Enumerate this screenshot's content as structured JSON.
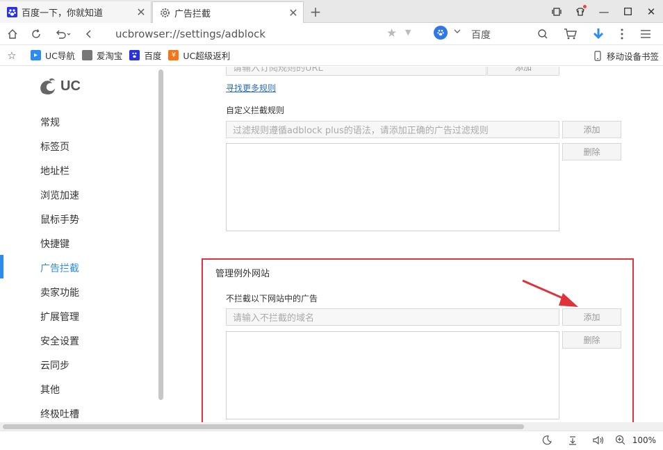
{
  "tabs": [
    {
      "title": "百度一下，你就知道",
      "icon": "baidu-paw-icon"
    },
    {
      "title": "广告拦截",
      "icon": "gear-icon"
    }
  ],
  "address": {
    "url": "ucbrowser://settings/adblock"
  },
  "search": {
    "engine": "百度"
  },
  "bookmarks": [
    {
      "label": "UC导航",
      "icon": "uc-nav-icon"
    },
    {
      "label": "爱淘宝",
      "icon": "page-icon"
    },
    {
      "label": "百度",
      "icon": "baidu-paw-icon"
    },
    {
      "label": "UC超级返利",
      "icon": "uc-rebate-icon"
    }
  ],
  "mobile_bookmarks": "移动设备书签",
  "logo": {
    "text": "UC"
  },
  "sidebar": {
    "items": [
      {
        "label": "常规"
      },
      {
        "label": "标签页"
      },
      {
        "label": "地址栏"
      },
      {
        "label": "浏览加速"
      },
      {
        "label": "鼠标手势"
      },
      {
        "label": "快捷键"
      },
      {
        "label": "广告拦截"
      },
      {
        "label": "卖家功能"
      },
      {
        "label": "扩展管理"
      },
      {
        "label": "安全设置"
      },
      {
        "label": "云同步"
      },
      {
        "label": "其他"
      },
      {
        "label": "终极吐槽"
      }
    ],
    "active_index": 6
  },
  "main": {
    "subscribe_placeholder": "请输入订阅规则的URL",
    "subscribe_add": "添加",
    "find_more": "寻找更多规则",
    "custom_rules_label": "自定义拦截规则",
    "custom_rules_placeholder": "过滤规则遵循adblock plus的语法，请添加正确的广告过滤规则",
    "custom_add": "添加",
    "custom_delete": "删除",
    "exceptions_title": "管理例外网站",
    "exceptions_label": "不拦截以下网站中的广告",
    "exceptions_placeholder": "请输入不拦截的域名",
    "exceptions_add": "添加",
    "exceptions_delete": "删除"
  },
  "status": {
    "zoom": "100%"
  },
  "colors": {
    "accent": "#2d8cf0",
    "highlight": "#e0323c"
  }
}
